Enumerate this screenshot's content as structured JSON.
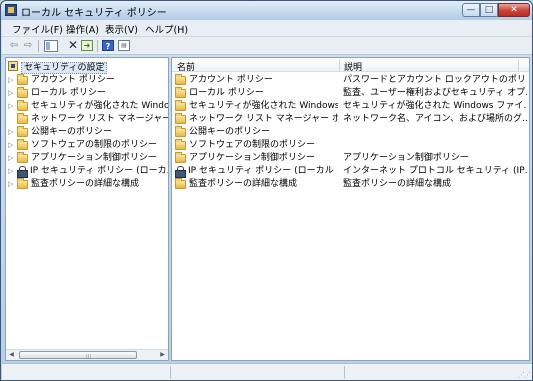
{
  "window": {
    "title": "ローカル セキュリティ ポリシー",
    "controls": {
      "minimize": "—",
      "maximize": "□",
      "close": "✕"
    }
  },
  "menubar": {
    "items": [
      {
        "label": "ファイル(F)"
      },
      {
        "label": "操作(A)"
      },
      {
        "label": "表示(V)"
      },
      {
        "label": "ヘルプ(H)"
      }
    ]
  },
  "toolbar": {
    "back_icon": "back-arrow-icon",
    "forward_icon": "forward-arrow-icon",
    "show_hide_tree_icon": "show-hide-tree-icon",
    "delete_icon": "delete-icon",
    "export_icon": "export-list-icon",
    "help_icon": "help-icon",
    "properties_icon": "properties-icon"
  },
  "tree": {
    "root_label": "セキュリティの設定",
    "items": [
      {
        "label": "アカウント ポリシー",
        "expandable": true,
        "icon": "folder"
      },
      {
        "label": "ローカル ポリシー",
        "expandable": true,
        "icon": "folder"
      },
      {
        "label": "セキュリティが強化された Windows",
        "expandable": true,
        "icon": "folder"
      },
      {
        "label": "ネットワーク リスト マネージャー ポ",
        "expandable": false,
        "icon": "folder"
      },
      {
        "label": "公開キーのポリシー",
        "expandable": true,
        "icon": "folder"
      },
      {
        "label": "ソフトウェアの制限のポリシー",
        "expandable": true,
        "icon": "folder"
      },
      {
        "label": "アプリケーション制御ポリシー",
        "expandable": true,
        "icon": "folder"
      },
      {
        "label": "IP セキュリティ ポリシー (ローカル",
        "expandable": true,
        "icon": "lock"
      },
      {
        "label": "監査ポリシーの詳細な構成",
        "expandable": true,
        "icon": "folder"
      }
    ]
  },
  "list": {
    "columns": {
      "name": "名前",
      "description": "説明"
    },
    "rows": [
      {
        "name": "アカウント ポリシー",
        "description": "パスワードとアカウント ロックアウトのポリ…",
        "icon": "folder"
      },
      {
        "name": "ローカル ポリシー",
        "description": "監査、ユーザー権利およびセキュリティ オプ…",
        "icon": "folder"
      },
      {
        "name": "セキュリティが強化された Windows …",
        "description": "セキュリティが強化された Windows ファイ…",
        "icon": "folder"
      },
      {
        "name": "ネットワーク リスト マネージャー ポ…",
        "description": "ネットワーク名、アイコン、および場所のグ…",
        "icon": "folder"
      },
      {
        "name": "公開キーのポリシー",
        "description": "",
        "icon": "folder"
      },
      {
        "name": "ソフトウェアの制限のポリシー",
        "description": "",
        "icon": "folder"
      },
      {
        "name": "アプリケーション制御ポリシー",
        "description": "アプリケーション制御ポリシー",
        "icon": "folder"
      },
      {
        "name": "IP セキュリティ ポリシー (ローカル コ…",
        "description": "インターネット プロトコル セキュリティ (IP…",
        "icon": "lock"
      },
      {
        "name": "監査ポリシーの詳細な構成",
        "description": "監査ポリシーの詳細な構成",
        "icon": "folder"
      }
    ]
  }
}
